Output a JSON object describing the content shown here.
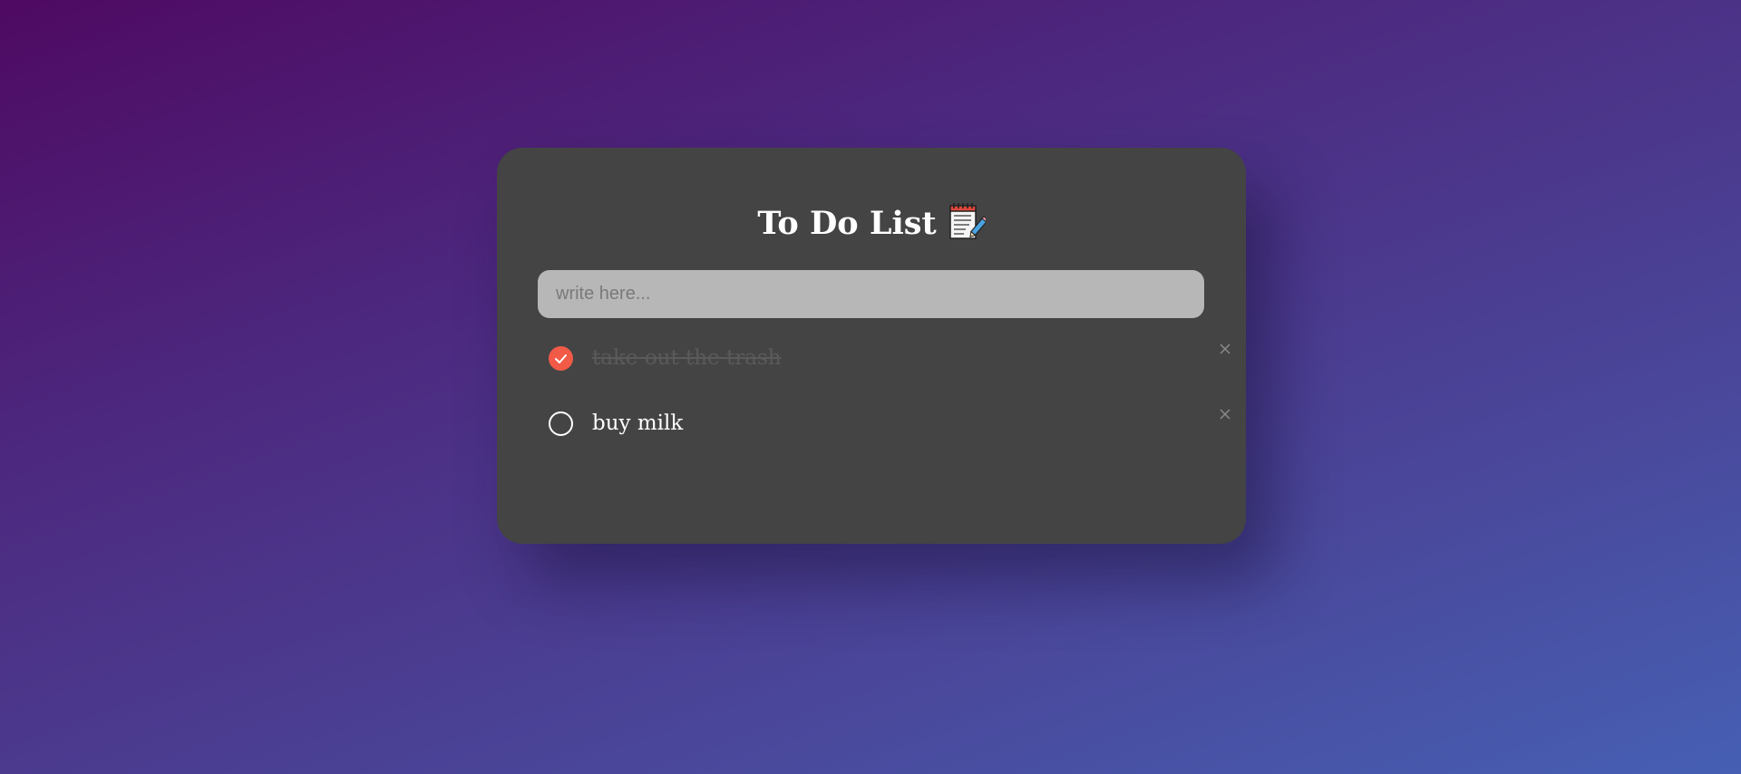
{
  "app": {
    "title": "To Do List",
    "title_icon": "notepad-pencil-icon"
  },
  "input": {
    "value": "",
    "placeholder": "write here..."
  },
  "items": [
    {
      "text": "take out the trash",
      "checked": true,
      "delete_icon": "close-icon"
    },
    {
      "text": "buy milk",
      "checked": false,
      "delete_icon": "close-icon"
    }
  ],
  "colors": {
    "card": "#444444",
    "check_accent": "#f25a48",
    "input_bg": "#b7b7b7",
    "gradient_start": "#4f0a63",
    "gradient_end": "#465fb3"
  }
}
